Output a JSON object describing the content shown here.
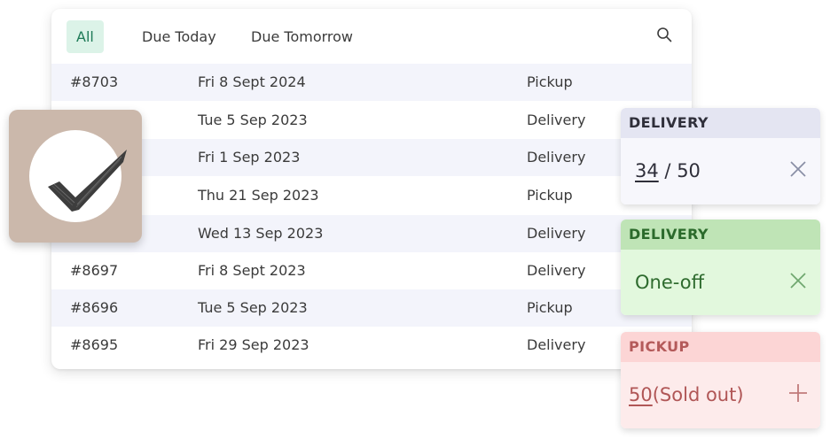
{
  "tabs": [
    {
      "label": "All",
      "active": true
    },
    {
      "label": "Due Today",
      "active": false
    },
    {
      "label": "Due Tomorrow",
      "active": false
    }
  ],
  "search_icon": "search-icon",
  "orders": [
    {
      "id": "#8703",
      "date": "Fri 8 Sept 2024",
      "type": "Pickup"
    },
    {
      "id": "",
      "date": "Tue 5 Sep 2023",
      "type": "Delivery"
    },
    {
      "id": "",
      "date": "Fri 1 Sep 2023",
      "type": "Delivery"
    },
    {
      "id": "",
      "date": "Thu 21 Sep 2023",
      "type": "Pickup"
    },
    {
      "id": "",
      "date": "Wed 13 Sep 2023",
      "type": "Delivery"
    },
    {
      "id": "#8697",
      "date": "Fri 8 Sept 2023",
      "type": "Delivery"
    },
    {
      "id": "#8696",
      "date": "Tue 5 Sep 2023",
      "type": "Pickup"
    },
    {
      "id": "#8695",
      "date": "Fri 29 Sep 2023",
      "type": "Delivery"
    }
  ],
  "check_badge_icon": "checkmark-icon",
  "cards": {
    "delivery_count": {
      "title": "DELIVERY",
      "count": "34",
      "separator": "/",
      "total": "50",
      "icon": "close-icon"
    },
    "delivery_oneoff": {
      "title": "DELIVERY",
      "value": "One-off",
      "icon": "close-icon"
    },
    "pickup": {
      "title": "PICKUP",
      "count": "50",
      "note": "(Sold out)",
      "icon": "plus-icon"
    }
  },
  "colors": {
    "active_tab_bg": "#dcf3e8",
    "active_tab_text": "#1e7a57",
    "row_alt_bg": "#f3f4fb",
    "delivery_card_head": "#e4e5f2",
    "oneoff_card_head": "#bfe4b6",
    "pickup_card_head": "#fcd5d5",
    "check_card_bg": "#cbb8ab"
  }
}
